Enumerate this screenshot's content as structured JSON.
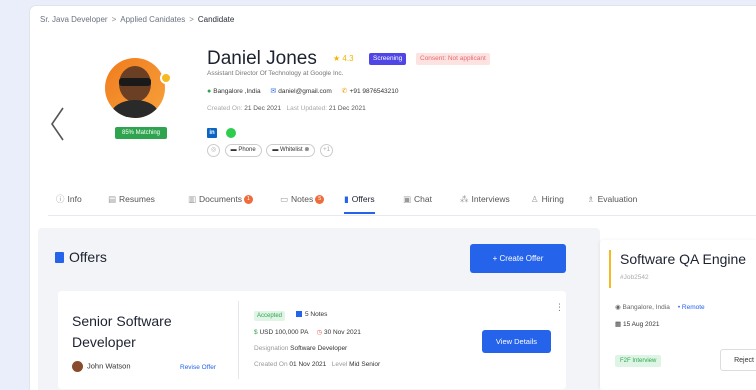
{
  "breadcrumb": {
    "items": [
      "Sr. Java Developer",
      "Applied Canidates",
      "Candidate"
    ]
  },
  "candidate": {
    "name": "Daniel Jones",
    "rating": "4.3",
    "status_tag": "Screening",
    "consent_tag": "Consent: Not applicant",
    "title": "Assistant Director Of Technology at Google Inc.",
    "location": "Bangalore ,India",
    "email": "daniel@gmail.com",
    "phone": "+91 9876543210",
    "created_label": "Created On",
    "created_date": "21 Dec 2021",
    "updated_label": "Last Updated",
    "updated_date": "21 Dec 2021",
    "match": "85% Matching",
    "pills": [
      "Phone",
      "Whitelist",
      "+1"
    ],
    "linkedin": "in"
  },
  "tabs": [
    {
      "label": "Info"
    },
    {
      "label": "Resumes"
    },
    {
      "label": "Documents",
      "count": "1"
    },
    {
      "label": "Notes",
      "count": "5"
    },
    {
      "label": "Offers"
    },
    {
      "label": "Chat"
    },
    {
      "label": "Interviews"
    },
    {
      "label": "Hiring"
    },
    {
      "label": "Evaluation"
    }
  ],
  "offers": {
    "title": "Offers",
    "create_label": "+ Create Offer",
    "card": {
      "job_title": "Senior Software Developer",
      "person": "John Watson",
      "revise_label": "Revise Offer",
      "status": "Accepted",
      "notes": "5 Notes",
      "salary": "USD 100,000 PA",
      "date": "30 Nov 2021",
      "designation_label": "Designation",
      "designation": "Software Developer",
      "created_label": "Created On",
      "created": "01 Nov 2021",
      "level_label": "Level",
      "level": "Mid Senior",
      "view_label": "View Details"
    }
  },
  "side_job": {
    "title": "Software QA Engine",
    "id": "#Job2542",
    "location": "Bangalore, India",
    "mode": "• Remote",
    "date": "15 Aug 2021",
    "tag": "F2F Interview",
    "reject_label": "Reject"
  }
}
